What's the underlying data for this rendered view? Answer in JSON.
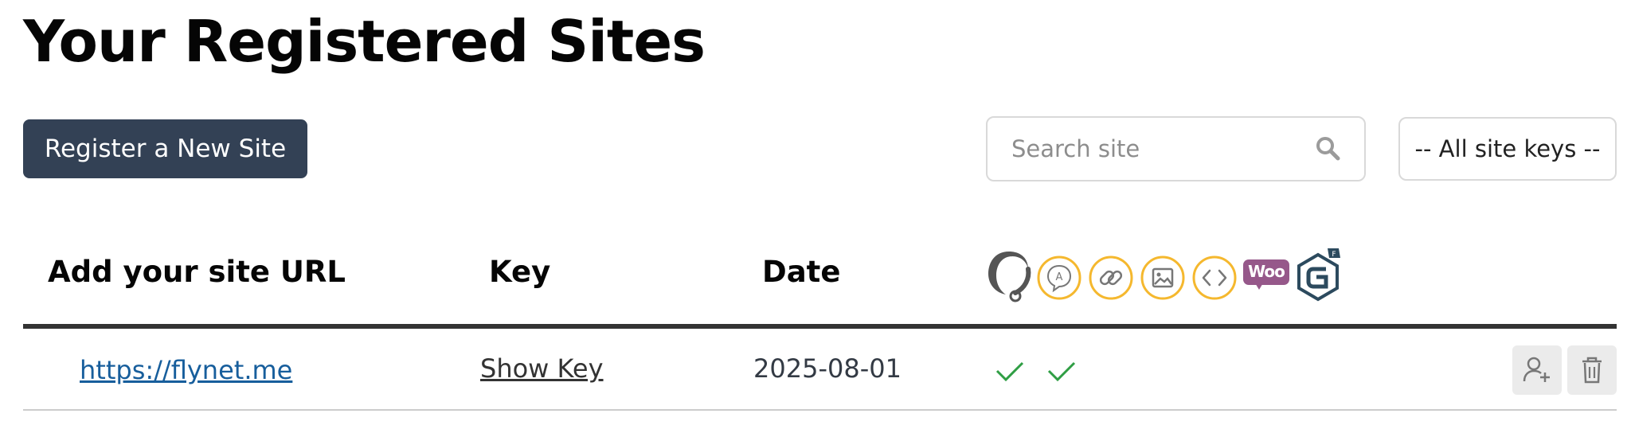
{
  "page": {
    "title": "Your Registered Sites"
  },
  "toolbar": {
    "register_label": "Register a New Site",
    "search_placeholder": "Search site",
    "search_value": "",
    "site_keys_select": "-- All site keys --"
  },
  "table": {
    "headers": {
      "url": "Add your site URL",
      "key": "Key",
      "date": "Date"
    },
    "feature_icons": [
      "quill-logo-icon",
      "ai-chat-icon",
      "link-icon",
      "image-icon",
      "code-icon",
      "woo-logo-icon",
      "gravity-forms-icon"
    ],
    "woo_text": "Woo",
    "rows": [
      {
        "url": "https://flynet.me",
        "key_label": "Show Key",
        "date": "2025-08-01",
        "features": [
          "check",
          "check"
        ]
      }
    ]
  },
  "colors": {
    "primary_button": "#334155",
    "link": "#175e9c",
    "feature_accent": "#f5b82e",
    "check": "#2f9e44",
    "woo": "#96588a",
    "gravity": "#2c4a5e"
  }
}
